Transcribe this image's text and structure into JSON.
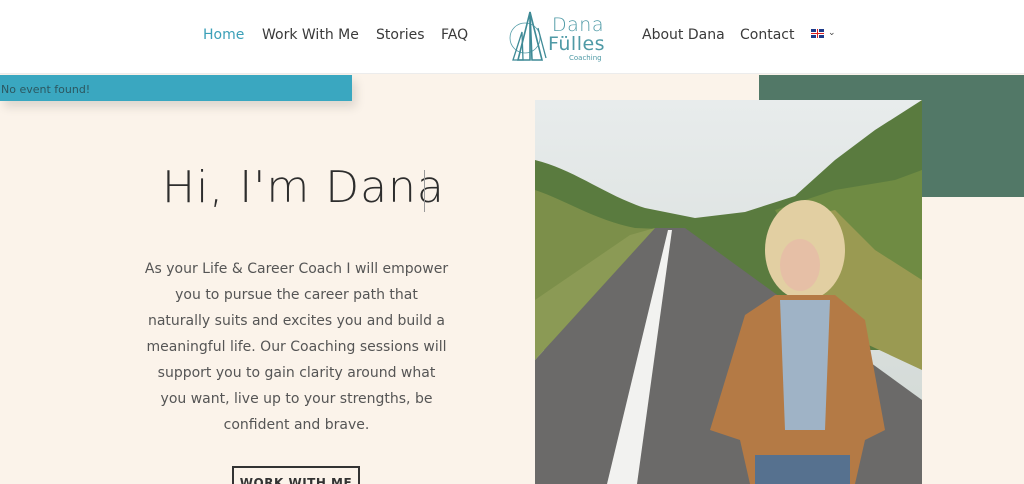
{
  "nav": {
    "home": "Home",
    "work_with_me": "Work With Me",
    "stories": "Stories",
    "faq": "FAQ",
    "about": "About Dana",
    "contact": "Contact"
  },
  "logo": {
    "line1": "Dana",
    "line2": "Fülles",
    "line3": "Coaching"
  },
  "language": {
    "flag": "uk-flag-icon"
  },
  "events_banner": {
    "text": "No event found!"
  },
  "hero": {
    "title": "Hi, I'm Dana",
    "description": "As your Life & Career Coach I will empower you to pursue the career path that naturally suits and excites you and build a meaningful life. Our Coaching sessions will support you to gain clarity around what you want, live up to your strengths, be confident and brave.",
    "cta_label": "WORK WITH ME"
  },
  "colors": {
    "accent": "#3ba0b8",
    "teal_bar": "#3aa7c0",
    "green_block": "#527867",
    "background": "#fbf3ea"
  }
}
